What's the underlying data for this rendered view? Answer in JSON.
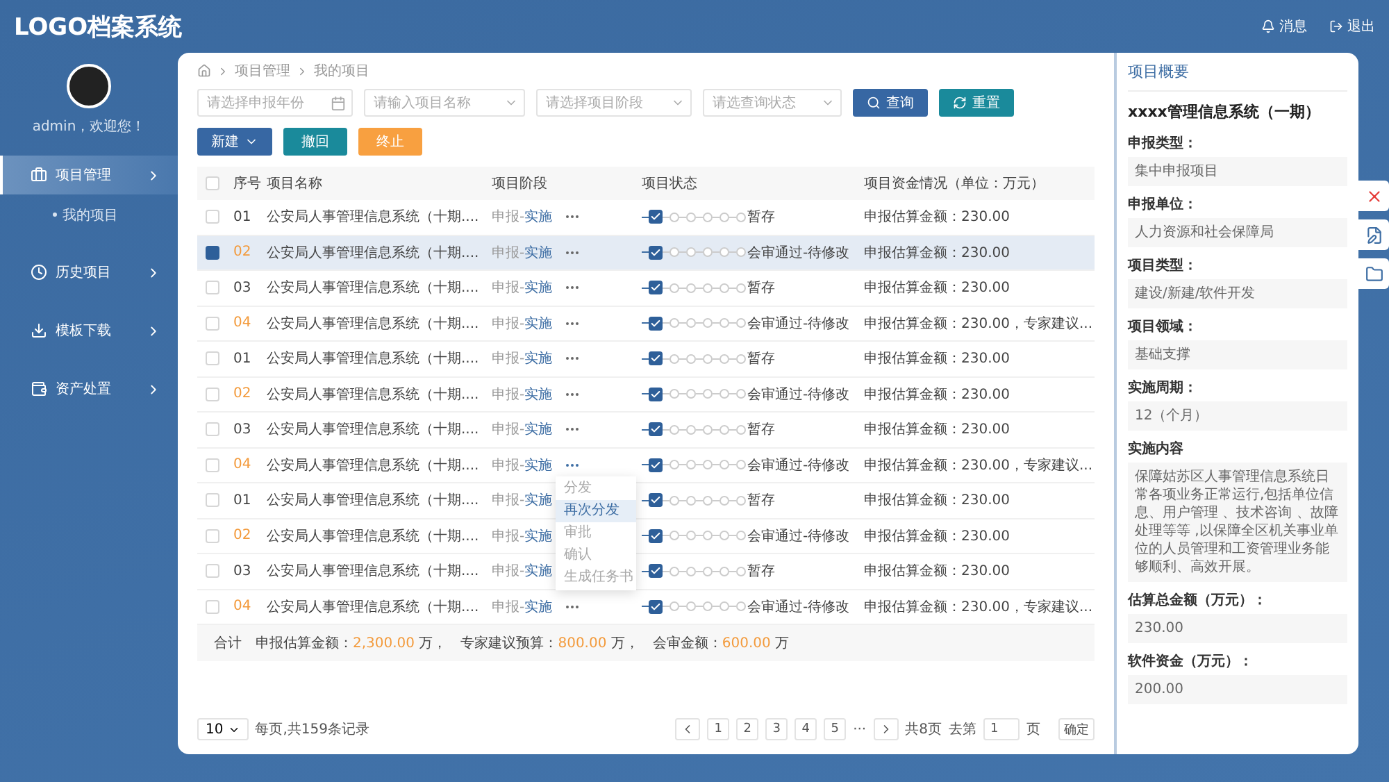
{
  "header": {
    "logo": "LOGO档案系统",
    "actions": [
      {
        "kind": "bell",
        "label": "消息"
      },
      {
        "kind": "exit",
        "label": "退出"
      }
    ]
  },
  "user": {
    "greeting": "admin，欢迎您！"
  },
  "sidebar": {
    "items": [
      {
        "kind": "briefcase",
        "label": "项目管理",
        "selected": true,
        "children": [
          {
            "label": "我的项目"
          }
        ]
      },
      {
        "kind": "clock",
        "label": "历史项目",
        "selected": false
      },
      {
        "kind": "download",
        "label": "模板下载",
        "selected": false
      },
      {
        "kind": "wallet",
        "label": "资产处置",
        "selected": false
      }
    ]
  },
  "breadcrumb": [
    "项目管理",
    "我的项目"
  ],
  "filters": [
    {
      "kind": "date",
      "placeholder": "请选择申报年份"
    },
    {
      "kind": "select",
      "placeholder": "请输入项目名称"
    },
    {
      "kind": "select",
      "placeholder": "请选择项目阶段"
    },
    {
      "kind": "select",
      "placeholder": "请选查询状态"
    }
  ],
  "search_buttons": [
    {
      "kind": "search",
      "label": "查询"
    },
    {
      "kind": "reset",
      "label": "重置"
    }
  ],
  "actions": [
    {
      "kind": "dropdown",
      "label": "新建"
    },
    {
      "kind": "teal",
      "label": "撤回"
    },
    {
      "kind": "orange",
      "label": "终止"
    }
  ],
  "table": {
    "all_checked": false,
    "columns": [
      "序号",
      "项目名称",
      "项目阶段",
      "项目状态",
      "项目资金情况（单位：万元）"
    ],
    "rows": [
      {
        "seq": "01",
        "flagged": false,
        "selected": false,
        "menu_open": false,
        "name": "公安局人事管理信息系统（十期....",
        "stage": {
          "done": "申报-",
          "current": "实施"
        },
        "steps": [
          true,
          false,
          false,
          false,
          false,
          false
        ],
        "status": "暂存",
        "funds": "申报估算金额：230.00"
      },
      {
        "seq": "02",
        "flagged": true,
        "selected": true,
        "menu_open": false,
        "name": "公安局人事管理信息系统（十期....",
        "stage": {
          "done": "申报-",
          "current": "实施"
        },
        "steps": [
          true,
          false,
          false,
          false,
          false,
          false
        ],
        "status": "会审通过-待修改",
        "funds": "申报估算金额：230.00"
      },
      {
        "seq": "03",
        "flagged": false,
        "selected": false,
        "menu_open": false,
        "name": "公安局人事管理信息系统（十期....",
        "stage": {
          "done": "申报-",
          "current": "实施"
        },
        "steps": [
          true,
          false,
          false,
          false,
          false,
          false
        ],
        "status": "暂存",
        "funds": "申报估算金额：230.00"
      },
      {
        "seq": "04",
        "flagged": true,
        "selected": false,
        "menu_open": false,
        "name": "公安局人事管理信息系统（十期....",
        "stage": {
          "done": "申报-",
          "current": "实施"
        },
        "steps": [
          true,
          false,
          false,
          false,
          false,
          false
        ],
        "status": "会审通过-待修改",
        "funds": "申报估算金额：230.00，专家建议..."
      },
      {
        "seq": "01",
        "flagged": false,
        "selected": false,
        "menu_open": false,
        "name": "公安局人事管理信息系统（十期....",
        "stage": {
          "done": "申报-",
          "current": "实施"
        },
        "steps": [
          true,
          false,
          false,
          false,
          false,
          false
        ],
        "status": "暂存",
        "funds": "申报估算金额：230.00"
      },
      {
        "seq": "02",
        "flagged": true,
        "selected": false,
        "menu_open": false,
        "name": "公安局人事管理信息系统（十期....",
        "stage": {
          "done": "申报-",
          "current": "实施"
        },
        "steps": [
          true,
          false,
          false,
          false,
          false,
          false
        ],
        "status": "会审通过-待修改",
        "funds": "申报估算金额：230.00"
      },
      {
        "seq": "03",
        "flagged": false,
        "selected": false,
        "menu_open": false,
        "name": "公安局人事管理信息系统（十期....",
        "stage": {
          "done": "申报-",
          "current": "实施"
        },
        "steps": [
          true,
          false,
          false,
          false,
          false,
          false
        ],
        "status": "暂存",
        "funds": "申报估算金额：230.00"
      },
      {
        "seq": "04",
        "flagged": true,
        "selected": false,
        "menu_open": true,
        "name": "公安局人事管理信息系统（十期....",
        "stage": {
          "done": "申报-",
          "current": "实施"
        },
        "steps": [
          true,
          false,
          false,
          false,
          false,
          false
        ],
        "status": "会审通过-待修改",
        "funds": "申报估算金额：230.00，专家建议..."
      },
      {
        "seq": "01",
        "flagged": false,
        "selected": false,
        "menu_open": false,
        "name": "公安局人事管理信息系统（十期....",
        "stage": {
          "done": "申报-",
          "current": "实施"
        },
        "steps": [
          true,
          false,
          false,
          false,
          false,
          false
        ],
        "status": "暂存",
        "funds": "申报估算金额：230.00"
      },
      {
        "seq": "02",
        "flagged": true,
        "selected": false,
        "menu_open": false,
        "name": "公安局人事管理信息系统（十期....",
        "stage": {
          "done": "申报-",
          "current": "实施"
        },
        "steps": [
          true,
          false,
          false,
          false,
          false,
          false
        ],
        "status": "会审通过-待修改",
        "funds": "申报估算金额：230.00"
      },
      {
        "seq": "03",
        "flagged": false,
        "selected": false,
        "menu_open": false,
        "name": "公安局人事管理信息系统（十期....",
        "stage": {
          "done": "申报-",
          "current": "实施"
        },
        "steps": [
          true,
          false,
          false,
          false,
          false,
          false
        ],
        "status": "暂存",
        "funds": "申报估算金额：230.00"
      },
      {
        "seq": "04",
        "flagged": true,
        "selected": false,
        "menu_open": false,
        "name": "公安局人事管理信息系统（十期....",
        "stage": {
          "done": "申报-",
          "current": "实施"
        },
        "steps": [
          true,
          false,
          false,
          false,
          false,
          false
        ],
        "status": "会审通过-待修改",
        "funds": "申报估算金额：230.00，专家建议..."
      }
    ],
    "menu": [
      {
        "label": "分发",
        "selected": false
      },
      {
        "label": "再次分发",
        "selected": true
      },
      {
        "label": "审批",
        "selected": false
      },
      {
        "label": "确认",
        "selected": false
      },
      {
        "label": "生成任务书",
        "selected": false
      }
    ],
    "total": {
      "label": "合计",
      "items": [
        {
          "label": "申报估算金额：",
          "value": "2,300.00",
          "unit": "万，"
        },
        {
          "label": "专家建议预算：",
          "value": "800.00",
          "unit": "万，"
        },
        {
          "label": "会审金额：",
          "value": "600.00",
          "unit": "万"
        }
      ]
    }
  },
  "pagination": {
    "page_size": "10",
    "summary": "每页,共159条记录",
    "pages": [
      "1",
      "2",
      "3",
      "4",
      "5"
    ],
    "ellipsis": "···",
    "total_pages": "共8页",
    "goto_label": "去第",
    "goto_value": "1",
    "goto_unit": "页",
    "confirm": "确定"
  },
  "panel": {
    "title": "项目概要",
    "name": "xxxx管理信息系统（一期）",
    "fields": [
      {
        "label": "申报类型：",
        "value": "集中申报项目"
      },
      {
        "label": "申报单位：",
        "value": "人力资源和社会保障局"
      },
      {
        "label": "项目类型：",
        "value": "建设/新建/软件开发"
      },
      {
        "label": "项目领域：",
        "value": "基础支撑"
      },
      {
        "label": "实施周期：",
        "value": "12（个月）"
      },
      {
        "label": "实施内容",
        "value": "保障姑苏区人事管理信息系统日常各项业务正常运行,包括单位信息、用户管理 、技术咨询 、故障处理等等 ,以保障全区机关事业单位的人员管理和工资管理业务能够顺利、高效开展。"
      },
      {
        "label": "估算总金额（万元）：",
        "value": "230.00"
      },
      {
        "label": "软件资金（万元）：",
        "value": "200.00"
      }
    ],
    "side_buttons": [
      {
        "kind": "close"
      },
      {
        "kind": "edit"
      },
      {
        "kind": "folder"
      }
    ]
  }
}
